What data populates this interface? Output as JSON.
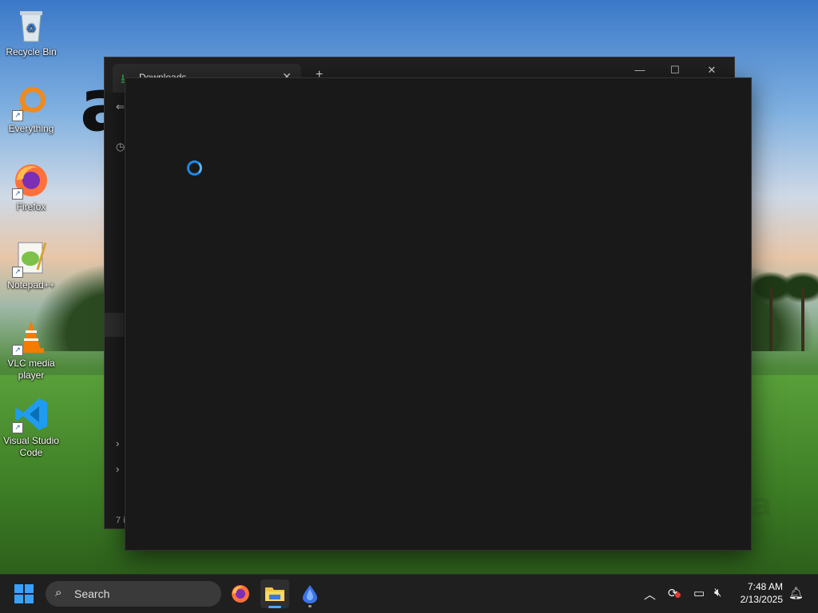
{
  "desktop": {
    "icons": [
      {
        "label": "Recycle Bin",
        "icon": "recycle-bin-icon"
      },
      {
        "label": "Everything",
        "icon": "everything-search-icon"
      },
      {
        "label": "Firefox",
        "icon": "firefox-icon"
      },
      {
        "label": "Notepad++",
        "icon": "notepad-plus-plus-icon"
      },
      {
        "label": "VLC media player",
        "icon": "vlc-icon"
      },
      {
        "label": "Visual Studio Code",
        "icon": "vscode-icon"
      }
    ]
  },
  "explorer": {
    "tab_label": "Downloads",
    "new_tab_glyph": "+",
    "status_text": "7 i"
  },
  "taskbar": {
    "search_placeholder": "Search",
    "time": "7:48 AM",
    "date": "2/13/2025"
  },
  "colors": {
    "accent": "#1e88e5",
    "taskbar_bg": "#1f1f1f",
    "window_bg": "#191919"
  }
}
